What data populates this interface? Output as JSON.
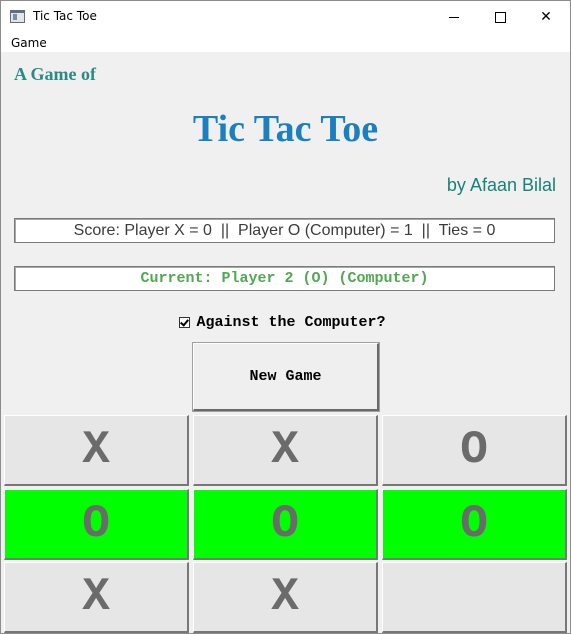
{
  "window": {
    "title": "Tic Tac Toe",
    "controls": {
      "minimize": "minimize",
      "maximize": "maximize",
      "close": "✕"
    }
  },
  "menu": {
    "items": [
      {
        "label": "Game"
      }
    ]
  },
  "header": {
    "subtitle": "A Game of",
    "title": "Tic Tac Toe",
    "byline": "by Afaan Bilal"
  },
  "score": {
    "text": "Score: Player X = 0  ||  Player O (Computer) = 1  ||  Ties = 0"
  },
  "status": {
    "current": "Current: Player 2 (O) (Computer)"
  },
  "options": {
    "against_computer_label": "Against the Computer?",
    "against_computer_checked": true
  },
  "actions": {
    "new_game_label": "New Game"
  },
  "board": {
    "cells": [
      {
        "mark": "X",
        "winning": false
      },
      {
        "mark": "X",
        "winning": false
      },
      {
        "mark": "O",
        "winning": false
      },
      {
        "mark": "O",
        "winning": true
      },
      {
        "mark": "O",
        "winning": true
      },
      {
        "mark": "O",
        "winning": true
      },
      {
        "mark": "X",
        "winning": false
      },
      {
        "mark": "X",
        "winning": false
      },
      {
        "mark": "",
        "winning": false
      }
    ]
  },
  "colors": {
    "win_cell": "#00ff00",
    "title": "#1b7fc0",
    "subtitle": "#2a8a84",
    "byline": "#17837a",
    "current_status": "#52a852",
    "mark": "#6b6b6b"
  }
}
